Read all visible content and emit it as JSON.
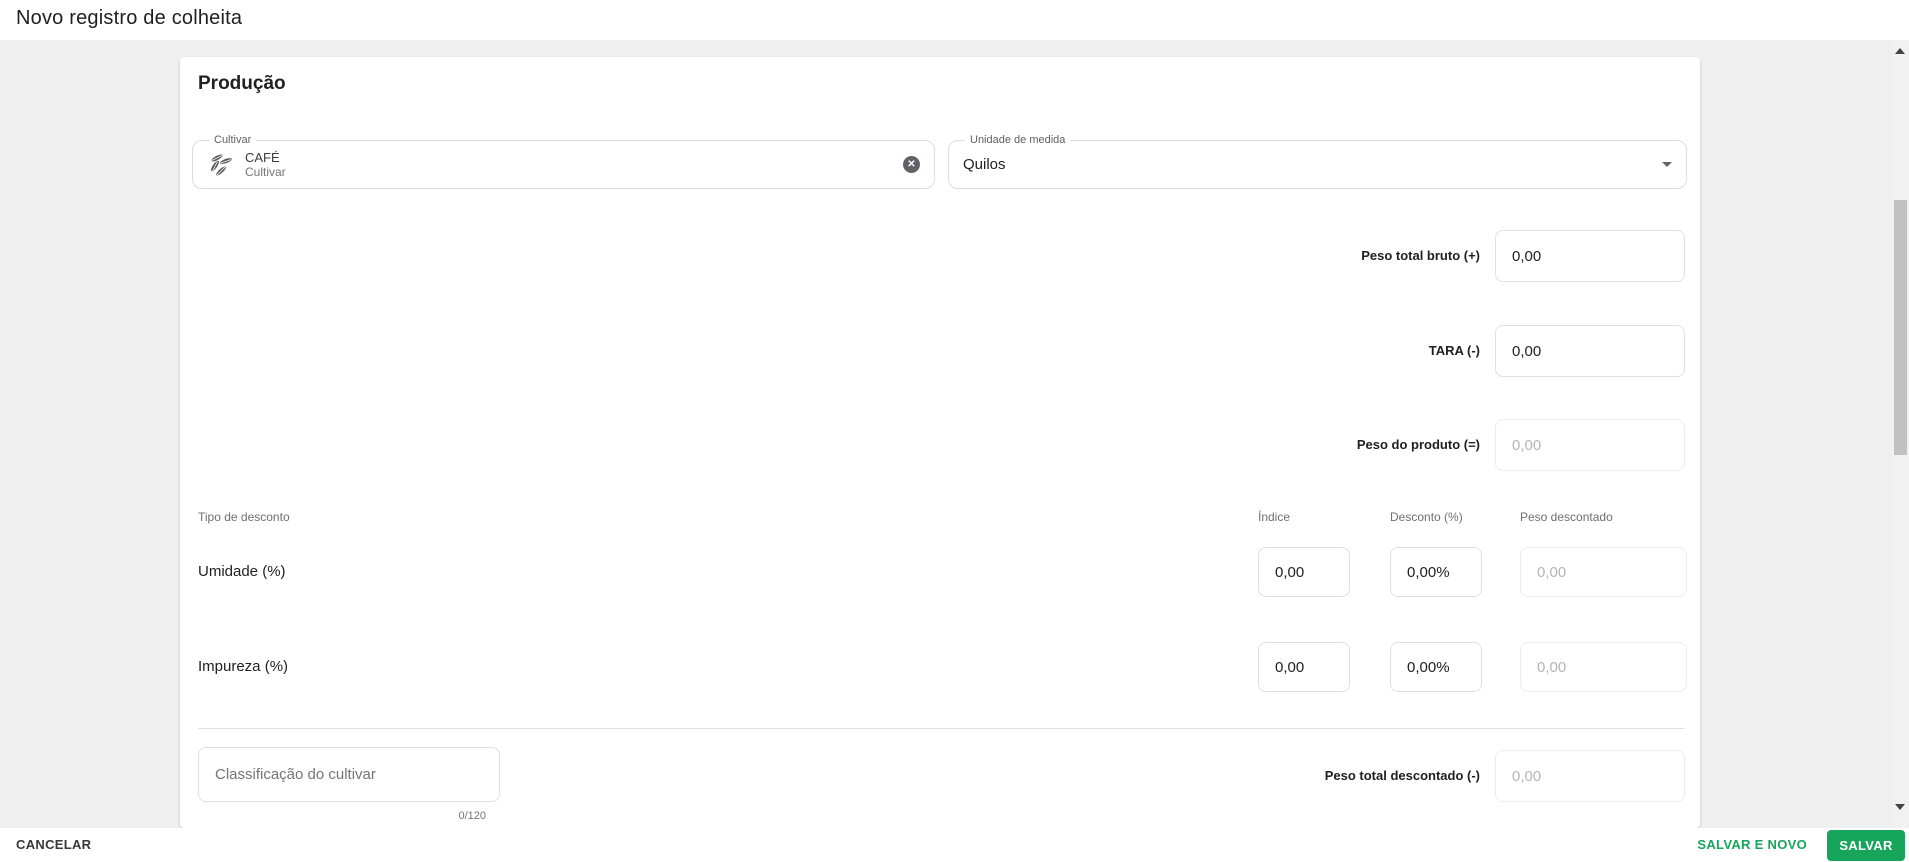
{
  "page": {
    "title": "Novo registro de colheita"
  },
  "card": {
    "section_title": "Produção",
    "cultivar": {
      "label": "Cultivar",
      "value": "CAFÉ",
      "sub_value": "Cultivar"
    },
    "unit": {
      "label": "Unidade de medida",
      "value": "Quilos"
    },
    "weights": [
      {
        "label": "Peso total bruto (+)",
        "value": "0,00"
      },
      {
        "label": "TARA (-)",
        "value": "0,00"
      },
      {
        "label": "Peso do produto (=)",
        "value": "0,00"
      }
    ],
    "discount_table": {
      "headers": [
        "Tipo de desconto",
        "Índice",
        "Desconto (%)",
        "Peso descontado"
      ],
      "rows": [
        {
          "label": "Umidade (%)",
          "indice": "0,00",
          "desconto": "0,00%",
          "peso": "0,00"
        },
        {
          "label": "Impureza (%)",
          "indice": "0,00",
          "desconto": "0,00%",
          "peso": "0,00"
        }
      ]
    },
    "classification": {
      "placeholder": "Classificação do cultivar",
      "counter": "0/120"
    },
    "total_discount": {
      "label": "Peso total descontado (-)",
      "value": "0,00"
    }
  },
  "footer": {
    "cancel": "CANCELAR",
    "save_and_new": "SALVAR E NOVO",
    "save": "SALVAR"
  },
  "colors": {
    "accent_green": "#16a55b",
    "background_gray": "#f0efef",
    "disabled_text": "#b4b4b4"
  }
}
